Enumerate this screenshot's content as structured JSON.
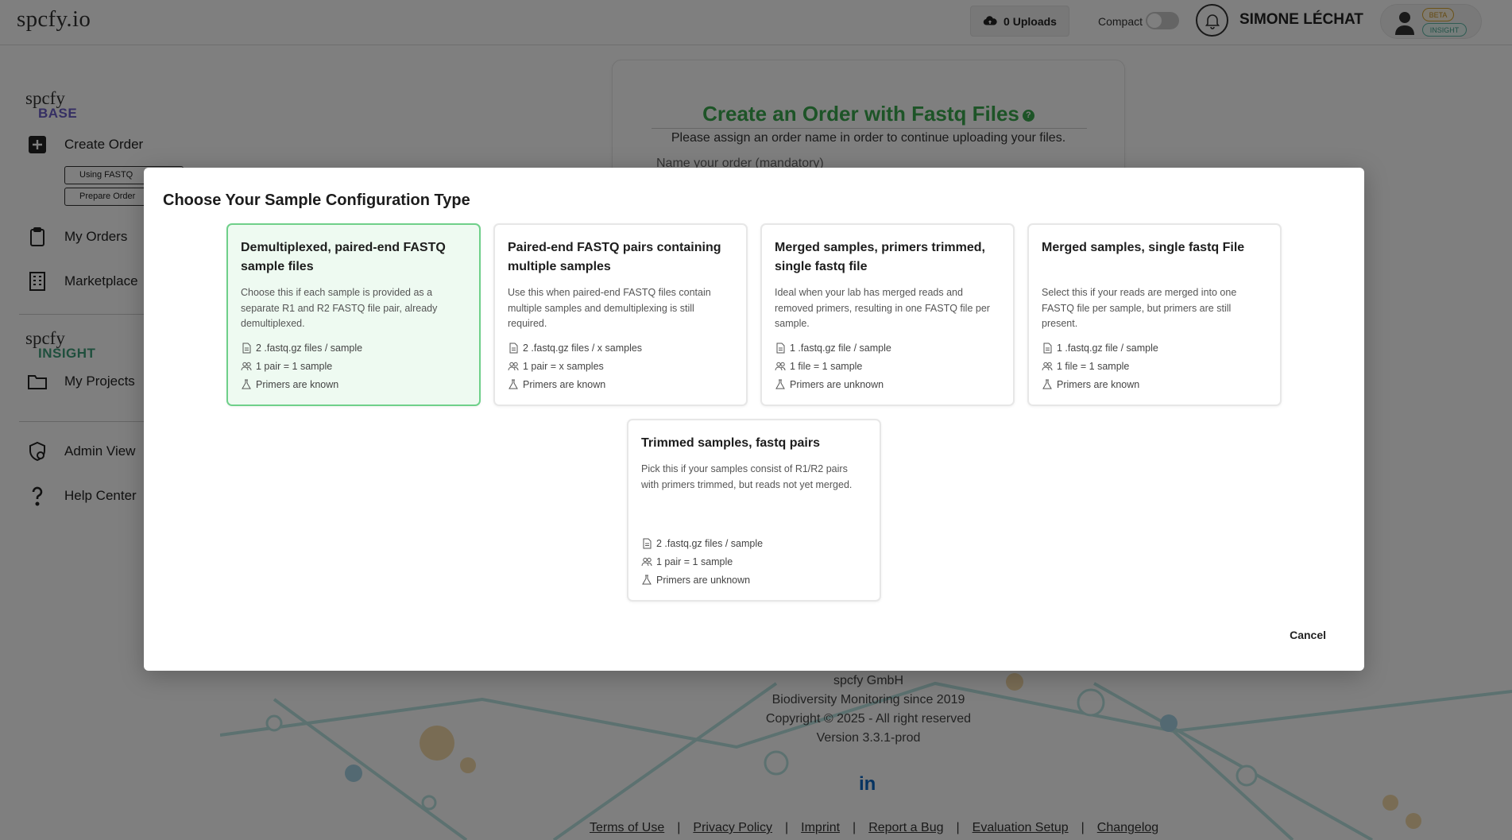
{
  "header": {
    "logo": "spcfy.io",
    "uploads_label": "0 Uploads",
    "compact_label": "Compact",
    "user_name": "SIMONE LÉCHAT",
    "badge_beta": "BETA",
    "badge_insight": "INSIGHT"
  },
  "sidebar": {
    "base_brand": "spcfy",
    "base_tag": "BASE",
    "create_order": "Create Order",
    "sub_fastq": "Using FASTQ",
    "sub_prepare": "Prepare Order",
    "my_orders": "My Orders",
    "marketplace": "Marketplace",
    "insight_brand": "spcfy",
    "insight_tag": "INSIGHT",
    "my_projects": "My Projects",
    "admin_view": "Admin View",
    "help_center": "Help Center"
  },
  "main": {
    "title": "Create an Order with Fastq Files",
    "subtitle": "Please assign an order name in order to continue uploading your files.",
    "name_label": "Name your order (mandatory)"
  },
  "footer": {
    "company": "spcfy GmbH",
    "tagline": "Biodiversity Monitoring since 2019",
    "copyright": "Copyright © 2025 - All right reserved",
    "version": "Version 3.3.1-prod",
    "linkedin": "in",
    "links": [
      "Terms of Use",
      "Privacy Policy",
      "Imprint",
      "Report a Bug",
      "Evaluation Setup",
      "Changelog"
    ],
    "separator": "|"
  },
  "modal": {
    "title": "Choose Your Sample Configuration Type",
    "cancel": "Cancel",
    "cards": [
      {
        "title": "Demultiplexed, paired-end FASTQ sample files",
        "desc": "Choose this if each sample is provided as a separate R1 and R2 FASTQ file pair, already demultiplexed.",
        "files": "2 .fastq.gz files / sample",
        "pairing": "1 pair = 1 sample",
        "primers": "Primers are known"
      },
      {
        "title": "Paired-end FASTQ pairs containing multiple samples",
        "desc": "Use this when paired-end FASTQ files contain multiple samples and demultiplexing is still required.",
        "files": "2 .fastq.gz files / x samples",
        "pairing": "1 pair = x samples",
        "primers": "Primers are known"
      },
      {
        "title": "Merged samples, primers trimmed, single fastq file",
        "desc": "Ideal when your lab has merged reads and removed primers, resulting in one FASTQ file per sample.",
        "files": "1 .fastq.gz file / sample",
        "pairing": "1 file = 1 sample",
        "primers": "Primers are unknown"
      },
      {
        "title": "Merged samples, single fastq File",
        "desc": "Select this if your reads are merged into one FASTQ file per sample, but primers are still present.",
        "files": "1 .fastq.gz file / sample",
        "pairing": "1 file = 1 sample",
        "primers": "Primers are known"
      },
      {
        "title": "Trimmed samples, fastq pairs",
        "desc": "Pick this if your samples consist of R1/R2 pairs with primers trimmed, but reads not yet merged.",
        "files": "2 .fastq.gz files / sample",
        "pairing": "1 pair = 1 sample",
        "primers": "Primers are unknown"
      }
    ]
  },
  "colors": {
    "accent_green": "#3aa84e",
    "selected_bg": "#eefaf1",
    "selected_border": "#6fd08a",
    "base_tag": "#6b5fc7",
    "insight_tag": "#3e9f7a"
  }
}
